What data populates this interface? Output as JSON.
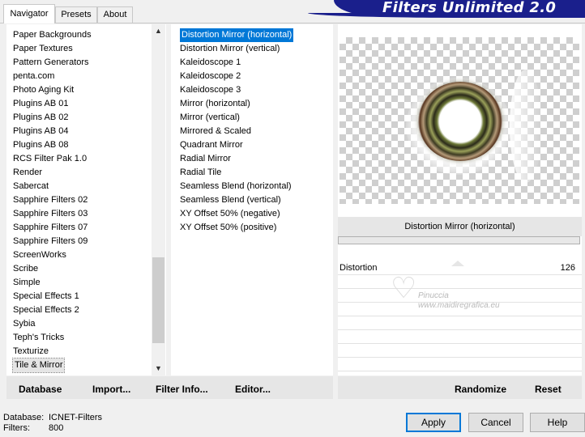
{
  "app": {
    "title": "Filters Unlimited 2.0"
  },
  "tabs": [
    {
      "label": "Navigator",
      "active": true
    },
    {
      "label": "Presets",
      "active": false
    },
    {
      "label": "About",
      "active": false
    }
  ],
  "navigator": {
    "items": [
      "Paper Backgrounds",
      "Paper Textures",
      "Pattern Generators",
      "penta.com",
      "Photo Aging Kit",
      "Plugins AB 01",
      "Plugins AB 02",
      "Plugins AB 04",
      "Plugins AB 08",
      "RCS Filter Pak 1.0",
      "Render",
      "Sabercat",
      "Sapphire Filters 02",
      "Sapphire Filters 03",
      "Sapphire Filters 07",
      "Sapphire Filters 09",
      "ScreenWorks",
      "Scribe",
      "Simple",
      "Special Effects 1",
      "Special Effects 2",
      "Sybia",
      "Teph's Tricks",
      "Texturize",
      "Tile & Mirror"
    ],
    "selected": "Tile & Mirror"
  },
  "filters": {
    "items": [
      "Distortion Mirror (horizontal)",
      "Distortion Mirror (vertical)",
      "Kaleidoscope 1",
      "Kaleidoscope 2",
      "Kaleidoscope 3",
      "Mirror (horizontal)",
      "Mirror (vertical)",
      "Mirrored & Scaled",
      "Quadrant Mirror",
      "Radial Mirror",
      "Radial Tile",
      "Seamless Blend (horizontal)",
      "Seamless Blend (vertical)",
      "XY Offset 50% (negative)",
      "XY Offset 50% (positive)"
    ],
    "selected": "Distortion Mirror (horizontal)"
  },
  "preview": {
    "filter_name": "Distortion Mirror (horizontal)",
    "slider_label": "Distortion",
    "slider_value": "126"
  },
  "watermark": {
    "name": "Pinuccia",
    "url": "www.maidiregrafica.eu"
  },
  "left_buttons": {
    "database": "Database",
    "import": "Import...",
    "filter_info": "Filter Info...",
    "editor": "Editor..."
  },
  "right_buttons": {
    "randomize": "Randomize",
    "reset": "Reset"
  },
  "status": {
    "database_label": "Database:",
    "database_value": "ICNET-Filters",
    "filters_label": "Filters:",
    "filters_value": "800"
  },
  "dialog_buttons": {
    "apply": "Apply",
    "cancel": "Cancel",
    "help": "Help"
  },
  "colors": {
    "banner": "#1a1f8c",
    "selection": "#0078d7"
  }
}
